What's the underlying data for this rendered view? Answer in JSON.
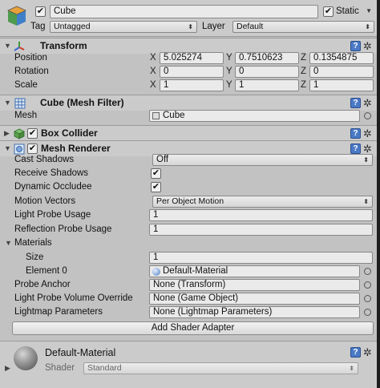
{
  "object": {
    "name": "Cube",
    "static_label": "Static",
    "tag_label": "Tag",
    "tag_value": "Untagged",
    "layer_label": "Layer",
    "layer_value": "Default"
  },
  "transform": {
    "title": "Transform",
    "position_label": "Position",
    "rotation_label": "Rotation",
    "scale_label": "Scale",
    "axis_x": "X",
    "axis_y": "Y",
    "axis_z": "Z",
    "position": [
      "5.025274",
      "0.7510623",
      "0.1354875"
    ],
    "rotation": [
      "0",
      "0",
      "0"
    ],
    "scale": [
      "1",
      "1",
      "1"
    ]
  },
  "mesh_filter": {
    "title": "Cube (Mesh Filter)",
    "mesh_label": "Mesh",
    "mesh_value": "Cube"
  },
  "box_collider": {
    "title": "Box Collider"
  },
  "mesh_renderer": {
    "title": "Mesh Renderer",
    "cast_shadows_label": "Cast Shadows",
    "cast_shadows_value": "Off",
    "receive_shadows_label": "Receive Shadows",
    "dynamic_occludee_label": "Dynamic Occludee",
    "motion_vectors_label": "Motion Vectors",
    "motion_vectors_value": "Per Object Motion",
    "light_probe_label": "Light Probe Usage",
    "light_probe_value": "1",
    "reflection_probe_label": "Reflection Probe Usage",
    "reflection_probe_value": "1",
    "materials_label": "Materials",
    "size_label": "Size",
    "size_value": "1",
    "element0_label": "Element 0",
    "element0_value": "Default-Material",
    "probe_anchor_label": "Probe Anchor",
    "probe_anchor_value": "None (Transform)",
    "lpvo_label": "Light Probe Volume Override",
    "lpvo_value": "None (Game Object)",
    "lightmap_params_label": "Lightmap Parameters",
    "lightmap_params_value": "None (Lightmap Parameters)",
    "add_shader_adapter": "Add Shader Adapter"
  },
  "material": {
    "name": "Default-Material",
    "shader_label": "Shader",
    "shader_value": "Standard"
  },
  "colors": {
    "panel_bg": "#c2c2c2",
    "header_bg": "#cbcbcb",
    "field_bg": "#eaeaea",
    "help_blue": "#4a79c6"
  },
  "icons": {
    "object": "cube-icon",
    "transform": "transform-axes-icon",
    "mesh_filter": "mesh-grid-icon",
    "box_collider": "box-collider-icon",
    "mesh_renderer": "mesh-renderer-icon",
    "help": "help-book-icon",
    "settings": "gear-icon",
    "material_preview": "sphere-icon"
  }
}
